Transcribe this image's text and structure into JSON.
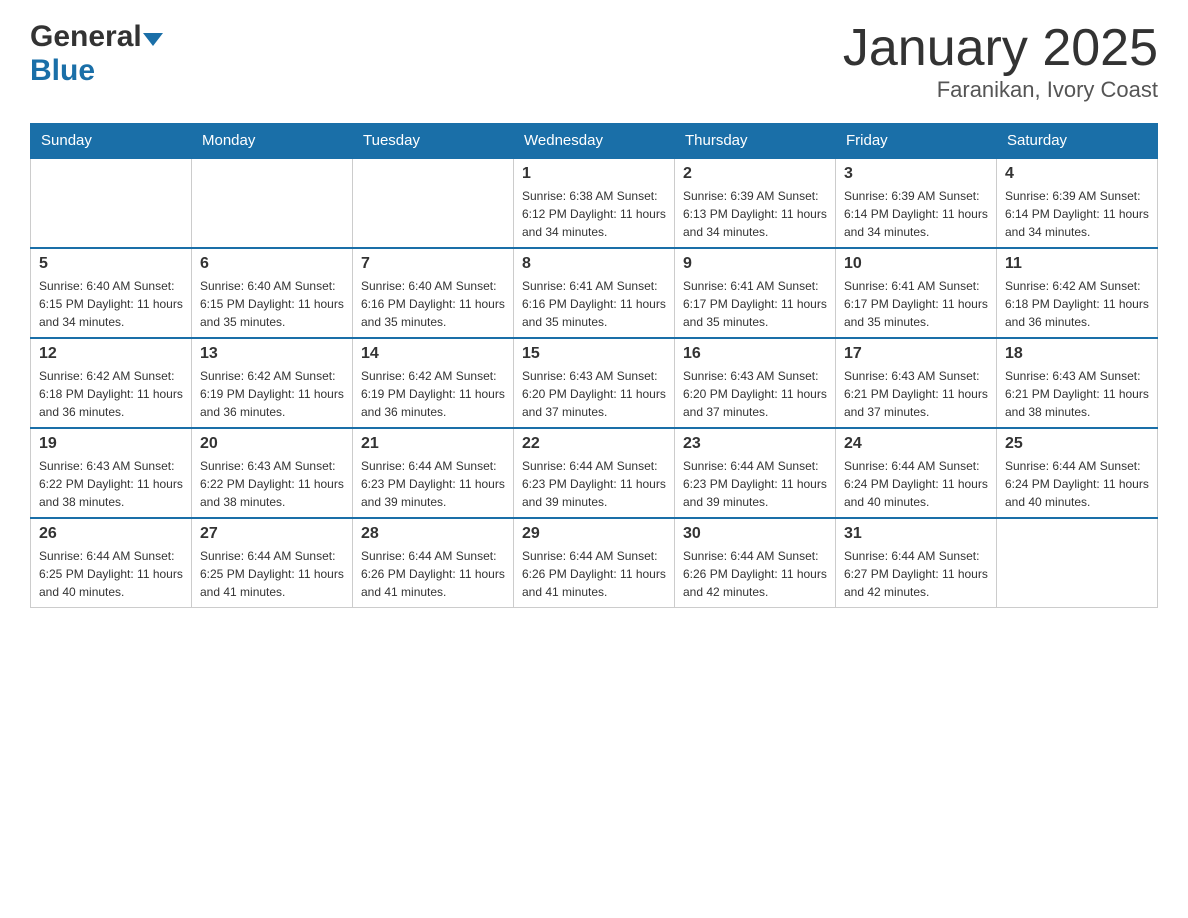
{
  "header": {
    "logo_general": "General",
    "logo_blue": "Blue",
    "month_title": "January 2025",
    "location": "Faranikan, Ivory Coast"
  },
  "days_of_week": [
    "Sunday",
    "Monday",
    "Tuesday",
    "Wednesday",
    "Thursday",
    "Friday",
    "Saturday"
  ],
  "weeks": [
    {
      "days": [
        {
          "date": "",
          "info": ""
        },
        {
          "date": "",
          "info": ""
        },
        {
          "date": "",
          "info": ""
        },
        {
          "date": "1",
          "info": "Sunrise: 6:38 AM\nSunset: 6:12 PM\nDaylight: 11 hours\nand 34 minutes."
        },
        {
          "date": "2",
          "info": "Sunrise: 6:39 AM\nSunset: 6:13 PM\nDaylight: 11 hours\nand 34 minutes."
        },
        {
          "date": "3",
          "info": "Sunrise: 6:39 AM\nSunset: 6:14 PM\nDaylight: 11 hours\nand 34 minutes."
        },
        {
          "date": "4",
          "info": "Sunrise: 6:39 AM\nSunset: 6:14 PM\nDaylight: 11 hours\nand 34 minutes."
        }
      ]
    },
    {
      "days": [
        {
          "date": "5",
          "info": "Sunrise: 6:40 AM\nSunset: 6:15 PM\nDaylight: 11 hours\nand 34 minutes."
        },
        {
          "date": "6",
          "info": "Sunrise: 6:40 AM\nSunset: 6:15 PM\nDaylight: 11 hours\nand 35 minutes."
        },
        {
          "date": "7",
          "info": "Sunrise: 6:40 AM\nSunset: 6:16 PM\nDaylight: 11 hours\nand 35 minutes."
        },
        {
          "date": "8",
          "info": "Sunrise: 6:41 AM\nSunset: 6:16 PM\nDaylight: 11 hours\nand 35 minutes."
        },
        {
          "date": "9",
          "info": "Sunrise: 6:41 AM\nSunset: 6:17 PM\nDaylight: 11 hours\nand 35 minutes."
        },
        {
          "date": "10",
          "info": "Sunrise: 6:41 AM\nSunset: 6:17 PM\nDaylight: 11 hours\nand 35 minutes."
        },
        {
          "date": "11",
          "info": "Sunrise: 6:42 AM\nSunset: 6:18 PM\nDaylight: 11 hours\nand 36 minutes."
        }
      ]
    },
    {
      "days": [
        {
          "date": "12",
          "info": "Sunrise: 6:42 AM\nSunset: 6:18 PM\nDaylight: 11 hours\nand 36 minutes."
        },
        {
          "date": "13",
          "info": "Sunrise: 6:42 AM\nSunset: 6:19 PM\nDaylight: 11 hours\nand 36 minutes."
        },
        {
          "date": "14",
          "info": "Sunrise: 6:42 AM\nSunset: 6:19 PM\nDaylight: 11 hours\nand 36 minutes."
        },
        {
          "date": "15",
          "info": "Sunrise: 6:43 AM\nSunset: 6:20 PM\nDaylight: 11 hours\nand 37 minutes."
        },
        {
          "date": "16",
          "info": "Sunrise: 6:43 AM\nSunset: 6:20 PM\nDaylight: 11 hours\nand 37 minutes."
        },
        {
          "date": "17",
          "info": "Sunrise: 6:43 AM\nSunset: 6:21 PM\nDaylight: 11 hours\nand 37 minutes."
        },
        {
          "date": "18",
          "info": "Sunrise: 6:43 AM\nSunset: 6:21 PM\nDaylight: 11 hours\nand 38 minutes."
        }
      ]
    },
    {
      "days": [
        {
          "date": "19",
          "info": "Sunrise: 6:43 AM\nSunset: 6:22 PM\nDaylight: 11 hours\nand 38 minutes."
        },
        {
          "date": "20",
          "info": "Sunrise: 6:43 AM\nSunset: 6:22 PM\nDaylight: 11 hours\nand 38 minutes."
        },
        {
          "date": "21",
          "info": "Sunrise: 6:44 AM\nSunset: 6:23 PM\nDaylight: 11 hours\nand 39 minutes."
        },
        {
          "date": "22",
          "info": "Sunrise: 6:44 AM\nSunset: 6:23 PM\nDaylight: 11 hours\nand 39 minutes."
        },
        {
          "date": "23",
          "info": "Sunrise: 6:44 AM\nSunset: 6:23 PM\nDaylight: 11 hours\nand 39 minutes."
        },
        {
          "date": "24",
          "info": "Sunrise: 6:44 AM\nSunset: 6:24 PM\nDaylight: 11 hours\nand 40 minutes."
        },
        {
          "date": "25",
          "info": "Sunrise: 6:44 AM\nSunset: 6:24 PM\nDaylight: 11 hours\nand 40 minutes."
        }
      ]
    },
    {
      "days": [
        {
          "date": "26",
          "info": "Sunrise: 6:44 AM\nSunset: 6:25 PM\nDaylight: 11 hours\nand 40 minutes."
        },
        {
          "date": "27",
          "info": "Sunrise: 6:44 AM\nSunset: 6:25 PM\nDaylight: 11 hours\nand 41 minutes."
        },
        {
          "date": "28",
          "info": "Sunrise: 6:44 AM\nSunset: 6:26 PM\nDaylight: 11 hours\nand 41 minutes."
        },
        {
          "date": "29",
          "info": "Sunrise: 6:44 AM\nSunset: 6:26 PM\nDaylight: 11 hours\nand 41 minutes."
        },
        {
          "date": "30",
          "info": "Sunrise: 6:44 AM\nSunset: 6:26 PM\nDaylight: 11 hours\nand 42 minutes."
        },
        {
          "date": "31",
          "info": "Sunrise: 6:44 AM\nSunset: 6:27 PM\nDaylight: 11 hours\nand 42 minutes."
        },
        {
          "date": "",
          "info": ""
        }
      ]
    }
  ]
}
